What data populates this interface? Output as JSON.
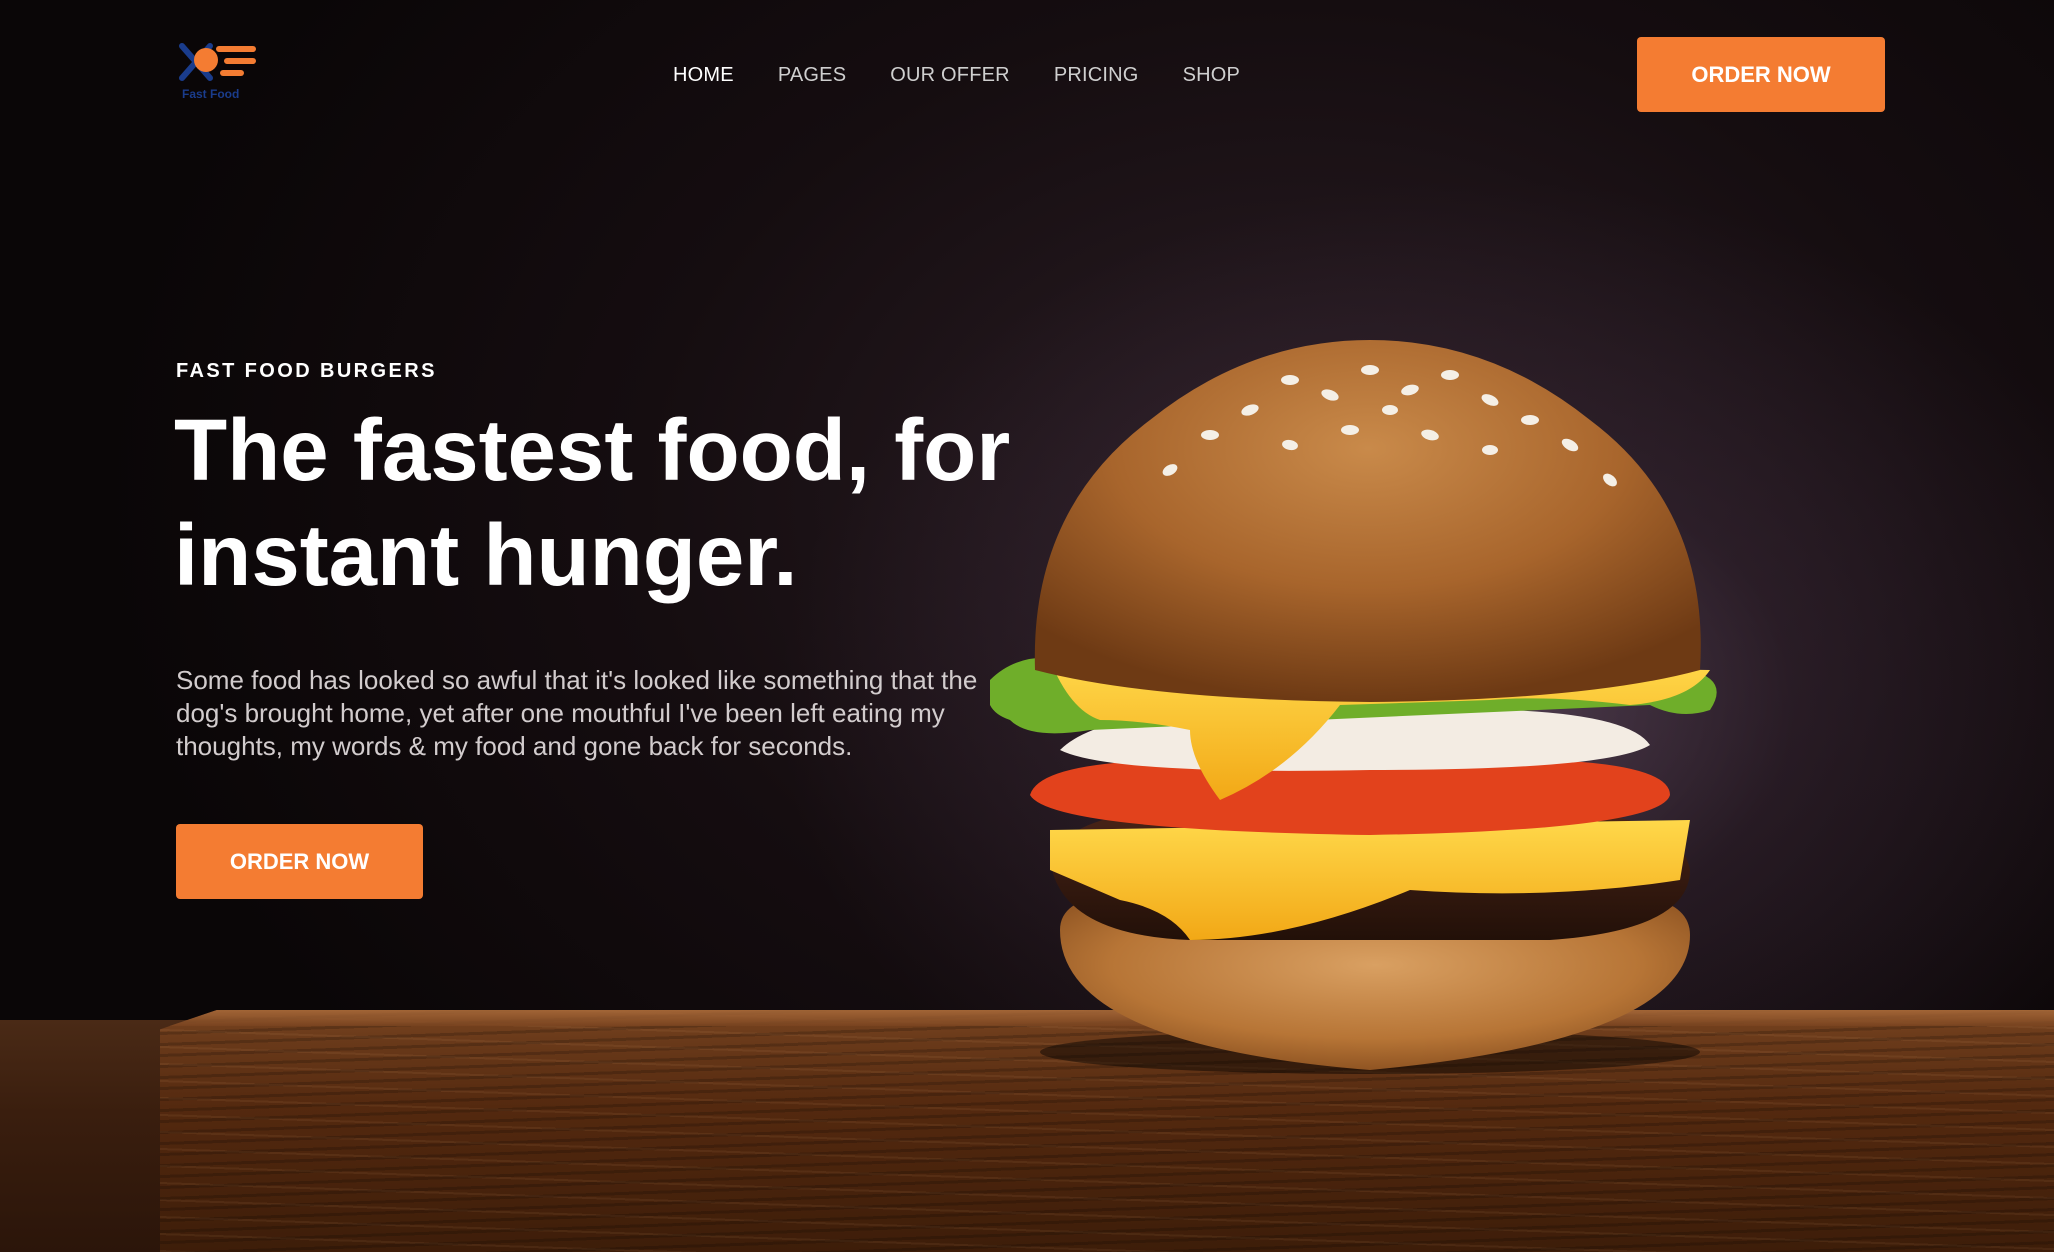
{
  "brand": {
    "logo_text": "Fast Food",
    "accent_color": "#f47c32",
    "logo_blue": "#1a3c8c"
  },
  "nav": {
    "items": [
      {
        "label": "HOME",
        "active": true
      },
      {
        "label": "PAGES",
        "active": false
      },
      {
        "label": "OUR OFFER",
        "active": false
      },
      {
        "label": "PRICING",
        "active": false
      },
      {
        "label": "SHOP",
        "active": false
      }
    ],
    "cta_label": "ORDER NOW"
  },
  "hero": {
    "eyebrow": "FAST FOOD BURGERS",
    "headline_line1": "The fastest food, for",
    "headline_line2": "instant hunger.",
    "description": "Some food has looked so awful that it's looked like something that the dog's brought home, yet after one mouthful I've been left eating my thoughts, my words & my food and gone back for seconds.",
    "cta_label": "ORDER NOW",
    "image": "burger-on-wooden-board"
  }
}
